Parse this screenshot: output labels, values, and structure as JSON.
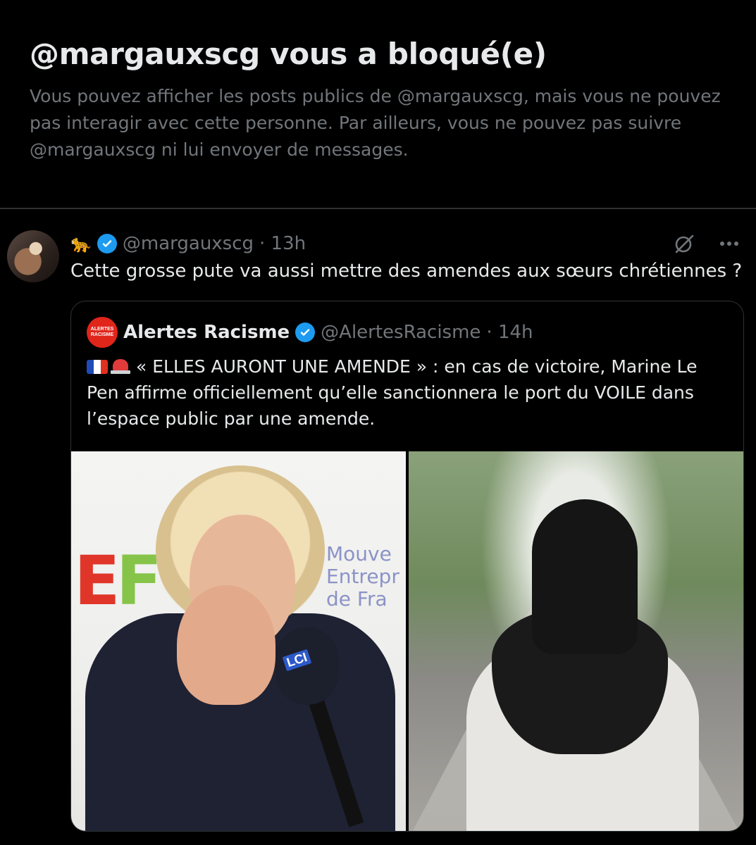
{
  "banner": {
    "title": "@margauxscg vous a bloqué(e)",
    "description": "Vous pouvez afficher les posts publics de @margauxscg, mais vous ne pouvez pas interagir avec cette personne. Par ailleurs, vous ne pouvez pas suivre @margauxscg ni lui envoyer de messages."
  },
  "post": {
    "display_name_emoji": "🐆",
    "handle": "@margauxscg",
    "time": "· 13h",
    "text": "Cette grosse pute va aussi mettre des amendes aux sœurs chrétiennes ?",
    "icons": [
      "grok-icon",
      "more-icon"
    ]
  },
  "quote": {
    "avatar_text_1": "ALERTES",
    "avatar_text_2": "RACISME",
    "name": "Alertes Racisme",
    "handle": "@AlertesRacisme",
    "time": "· 14h",
    "text": "« ELLES AURONT UNE AMENDE » : en cas de victoire, Marine Le Pen affirme officiellement qu’elle sanctionnera le port du VOILE dans l’espace public par une amende.",
    "image_left": {
      "logo_text_1": "E",
      "logo_text_2": "F",
      "backdrop_line_1": "Mouve",
      "backdrop_line_2": "Entrepr",
      "backdrop_line_3": "de Fra",
      "mic_label": "LCI"
    }
  },
  "colors": {
    "background": "#000000",
    "text_primary": "#e7e9ea",
    "text_secondary": "#71767b",
    "verified_blue": "#1d9bf0",
    "border": "#2f3336"
  }
}
